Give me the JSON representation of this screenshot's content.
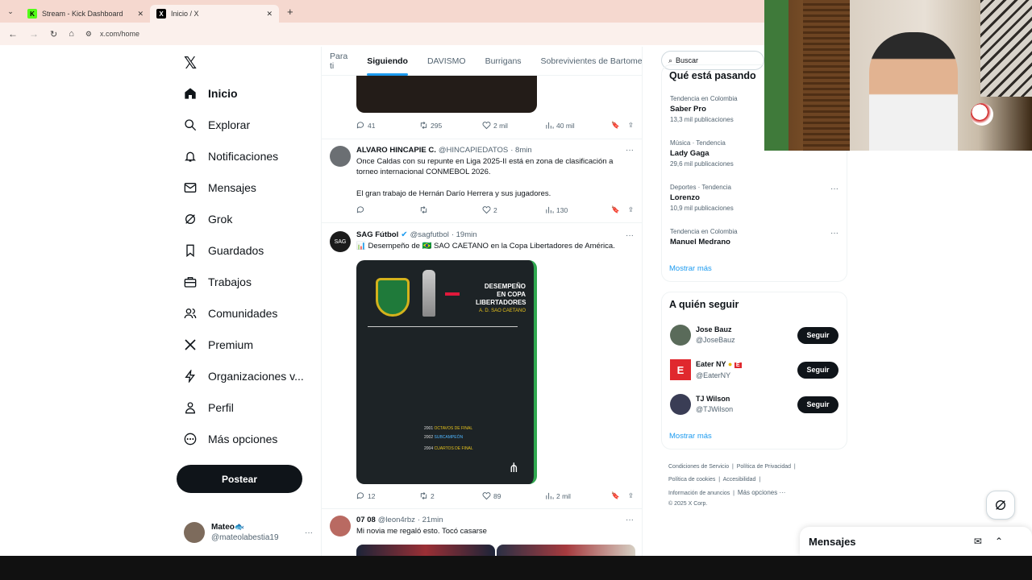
{
  "browser": {
    "tabs": [
      {
        "title": "Stream - Kick Dashboard",
        "favicon": "K",
        "color": "#53fc18"
      },
      {
        "title": "Inicio / X",
        "favicon": "X",
        "color": "#000000"
      }
    ],
    "url": "x.com/home"
  },
  "leftnav": {
    "items": [
      {
        "label": "Inicio",
        "icon": "home-icon"
      },
      {
        "label": "Explorar",
        "icon": "search-icon"
      },
      {
        "label": "Notificaciones",
        "icon": "bell-icon"
      },
      {
        "label": "Mensajes",
        "icon": "mail-icon"
      },
      {
        "label": "Grok",
        "icon": "grok-icon"
      },
      {
        "label": "Guardados",
        "icon": "bookmark-icon"
      },
      {
        "label": "Trabajos",
        "icon": "briefcase-icon"
      },
      {
        "label": "Comunidades",
        "icon": "people-icon"
      },
      {
        "label": "Premium",
        "icon": "x-logo-icon"
      },
      {
        "label": "Organizaciones v...",
        "icon": "lightning-icon"
      },
      {
        "label": "Perfil",
        "icon": "person-icon"
      },
      {
        "label": "Más opciones",
        "icon": "more-circle-icon"
      }
    ],
    "post_label": "Postear",
    "account": {
      "name": "Mateo🐟",
      "handle": "@mateolabestia19"
    }
  },
  "timeline": {
    "tabs": [
      "Para ti",
      "Siguiendo",
      "DAVISMO",
      "Burrigans",
      "Sobrevivientes de Bartomeu"
    ],
    "tweet0_actions": {
      "replies": "41",
      "reposts": "295",
      "likes": "2 mil",
      "views": "40 mil"
    },
    "tweets": [
      {
        "name": "ALVARO HINCAPIE C.",
        "handle": "@HINCAPIEDATOS",
        "time": "· 8min",
        "text1": "Once Caldas con su repunte en Liga 2025-II está en zona de clasificación a torneo internacional CONMEBOL 2026.",
        "text2": "El gran trabajo de Hernán Darío Herrera y sus jugadores.",
        "replies": "",
        "reposts": "",
        "likes": "2",
        "views": "130"
      },
      {
        "name": "SAG Fútbol",
        "handle": "@sagfutbol",
        "time": "· 19min",
        "text1": "📊 Desempeño de 🇧🇷 SAO CAETANO en la Copa Libertadores de América.",
        "image_title": "DESEMPEÑO EN COPA LIBERTADORES",
        "image_subtitle": "A. D. SAO CAETANO",
        "image_rows": [
          {
            "year": "2001",
            "result": "OCTAVOS DE FINAL"
          },
          {
            "year": "2002",
            "result": "SUBCAMPEÓN"
          },
          {
            "year": "2004",
            "result": "CUARTOS DE FINAL"
          }
        ],
        "replies": "12",
        "reposts": "2",
        "likes": "89",
        "views": "2 mil"
      },
      {
        "name": "07 08",
        "handle": "@leon4rbz",
        "time": "· 21min",
        "text1": "Mi novia me regaló esto. Tocó casarse"
      }
    ]
  },
  "search": {
    "placeholder": "Buscar"
  },
  "trends": {
    "heading": "Qué está pasando",
    "items": [
      {
        "context": "Tendencia en Colombia",
        "name": "Saber Pro",
        "count": "13,3 mil publicaciones"
      },
      {
        "context": "Música · Tendencia",
        "name": "Lady Gaga",
        "count": "29,6 mil publicaciones"
      },
      {
        "context": "Deportes · Tendencia",
        "name": "Lorenzo",
        "count": "10,9 mil publicaciones"
      },
      {
        "context": "Tendencia en Colombia",
        "name": "Manuel Medrano",
        "count": ""
      }
    ],
    "show_more": "Mostrar más"
  },
  "who_to_follow": {
    "heading": "A quién seguir",
    "items": [
      {
        "name": "Jose Bauz",
        "handle": "@JoseBauz"
      },
      {
        "name": "Eater NY",
        "handle": "@EaterNY"
      },
      {
        "name": "TJ Wilson",
        "handle": "@TJWilson"
      }
    ],
    "follow_label": "Seguir",
    "show_more": "Mostrar más"
  },
  "footer": {
    "links": [
      "Condiciones de Servicio",
      "Política de Privacidad",
      "Política de cookies",
      "Accesibilidad",
      "Información de anuncios",
      "Más opciones ···"
    ],
    "copyright": "© 2025 X Corp."
  },
  "messages": {
    "title": "Mensajes"
  },
  "colors": {
    "accent": "#1d9bf0",
    "text": "#0f1419",
    "muted": "#536471"
  }
}
